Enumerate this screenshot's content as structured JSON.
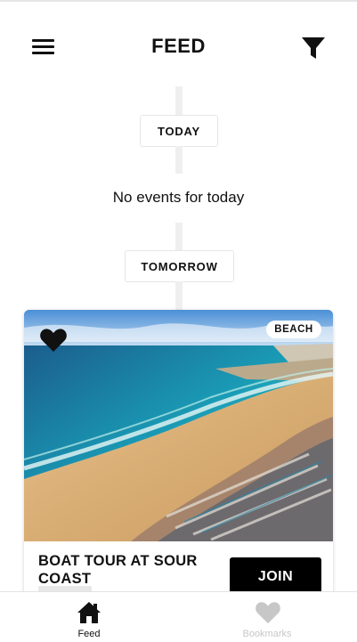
{
  "header": {
    "title": "FEED",
    "menu_icon": "hamburger-menu-icon",
    "filter_icon": "filter-funnel-icon"
  },
  "timeline": {
    "today_label": "TODAY",
    "today_empty_text": "No events for today",
    "tomorrow_label": "TOMORROW"
  },
  "event_card": {
    "title": "BOAT TOUR AT SOUR COAST",
    "tag": "BEACH",
    "join_label": "JOIN",
    "favorite_icon": "heart-filled-icon",
    "image": "beach-aerial-photo"
  },
  "tabbar": {
    "tabs": [
      {
        "label": "Feed",
        "icon": "home-icon",
        "active": true
      },
      {
        "label": "Bookmarks",
        "icon": "heart-icon",
        "active": false
      }
    ]
  },
  "colors": {
    "primary": "#000000",
    "background": "#ffffff",
    "timeline": "#efefef",
    "inactive": "#c7c7c7"
  }
}
